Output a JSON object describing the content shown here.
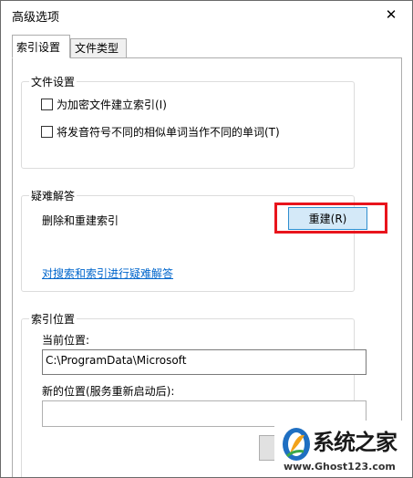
{
  "window": {
    "title": "高级选项",
    "close_glyph": "✕"
  },
  "tabs": [
    {
      "label": "索引设置",
      "active": true
    },
    {
      "label": "文件类型",
      "active": false
    }
  ],
  "file_settings": {
    "title": "文件设置",
    "encrypt_checkbox": {
      "label": "为加密文件建立索引(I)",
      "checked": false
    },
    "diacritics_checkbox": {
      "label": "将发音符号不同的相似单词当作不同的单词(T)",
      "checked": false
    }
  },
  "troubleshooting": {
    "title": "疑难解答",
    "rebuild_label": "删除和重建索引",
    "rebuild_button": "重建(R)",
    "link": "对搜索和索引进行疑难解答"
  },
  "index_location": {
    "title": "索引位置",
    "current_label": "当前位置:",
    "current_value": "C:\\ProgramData\\Microsoft",
    "new_label": "新的位置(服务重新启动后):",
    "new_value": ""
  },
  "watermark": {
    "brand": "系统之家",
    "url": "www.Ghost123.com"
  },
  "colors": {
    "highlight": "#e8141c",
    "button_fill": "#d4e9f8",
    "button_border": "#2f8ecf",
    "link": "#0066cc"
  }
}
